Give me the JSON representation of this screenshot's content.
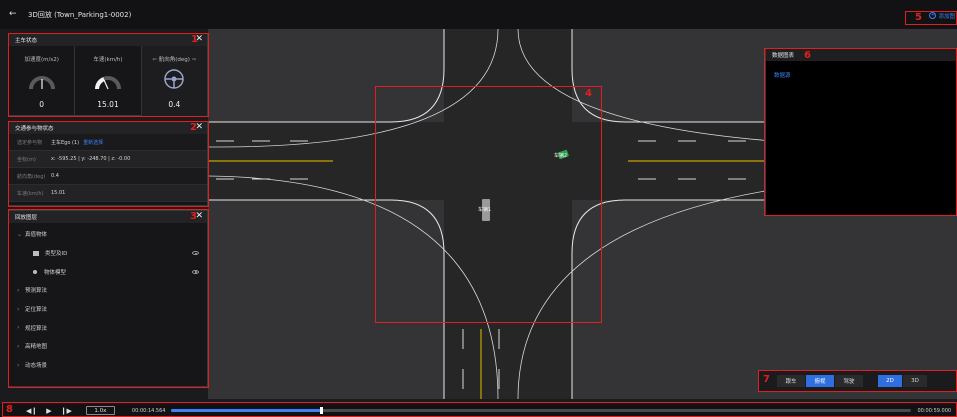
{
  "header": {
    "back_icon": "arrow-left-icon",
    "title": "3D回放 (Town_Parking1-0002)",
    "add_chart_label": "添加图"
  },
  "panels": {
    "vehicle_state": {
      "title": "主车状态",
      "gauges": [
        {
          "label": "加速度(m/s2)",
          "value": "0"
        },
        {
          "label": "车速(km/h)",
          "value": "15.01"
        },
        {
          "label": "航向角(deg)",
          "value": "0.4"
        }
      ]
    },
    "traffic": {
      "title": "交通参与物状态",
      "rows": [
        {
          "key": "选定参与物",
          "value": "主车Ego (1)",
          "link": "重新选择"
        },
        {
          "key": "坐标(m)",
          "value": "x: -595.25 | y: -248.70 | z: -0.00"
        },
        {
          "key": "航向角(deg)",
          "value": "0.4"
        },
        {
          "key": "车速(km/h)",
          "value": "15.01"
        }
      ]
    },
    "layers": {
      "title": "回放图层",
      "items": [
        {
          "label": "真值物体",
          "expanded": true
        },
        {
          "label": "类型及ID",
          "child": true,
          "icon": "grid"
        },
        {
          "label": "物体模型",
          "child": true,
          "icon": "dot"
        },
        {
          "label": "预测算法"
        },
        {
          "label": "定位算法"
        },
        {
          "label": "规控算法"
        },
        {
          "label": "高精地图"
        },
        {
          "label": "动态场景"
        }
      ]
    }
  },
  "map": {
    "vehicles": [
      {
        "label": "车辆2"
      },
      {
        "label": "车辆1"
      }
    ]
  },
  "data_chart": {
    "title": "数据图表",
    "source_link": "数据源"
  },
  "view_modes": {
    "camera": [
      "跟车",
      "俯视",
      "驾驶"
    ],
    "active_camera": "俯视",
    "dims": [
      "2D",
      "3D"
    ],
    "active_dim": "2D"
  },
  "playback": {
    "speed": "1.0x",
    "current_time": "00:00:14.564",
    "end_time": "00:00:59.000",
    "progress": 0.202
  },
  "annotations": [
    "1",
    "2",
    "3",
    "4",
    "5",
    "6",
    "7",
    "8"
  ],
  "colors": {
    "accent": "#3b82f6",
    "annotation": "#e02020",
    "lane_yellow": "#c8a400"
  }
}
